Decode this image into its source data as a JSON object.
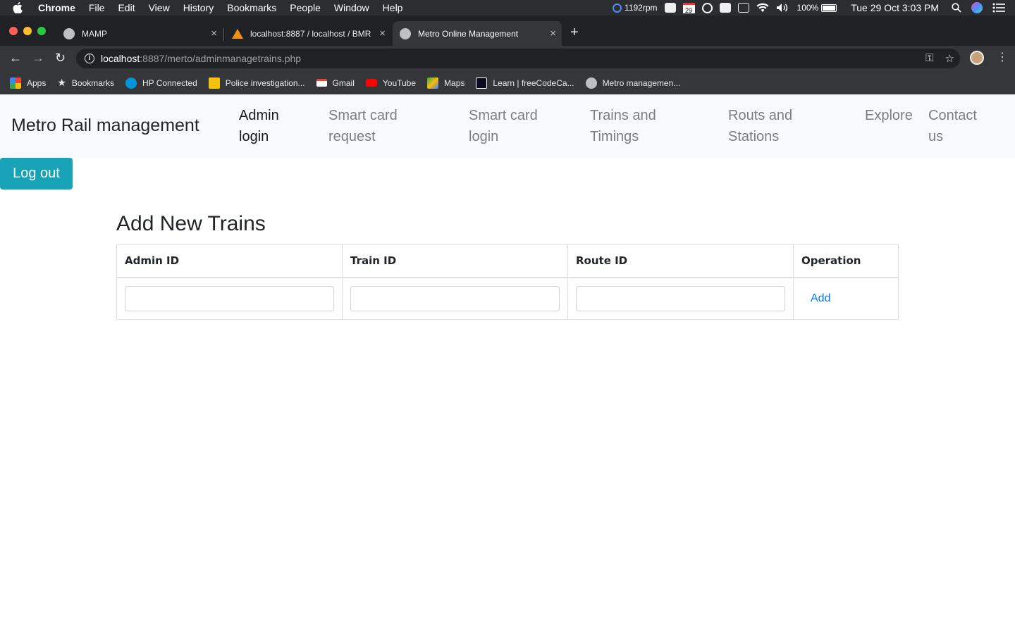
{
  "menubar": {
    "items": [
      "Chrome",
      "File",
      "Edit",
      "View",
      "History",
      "Bookmarks",
      "People",
      "Window",
      "Help"
    ],
    "status": {
      "fan": "1192rpm",
      "calendar_day": "29",
      "battery": "100%",
      "datetime": "Tue 29 Oct  3:03 PM"
    }
  },
  "tabs": [
    {
      "title": "MAMP",
      "close": "×"
    },
    {
      "title": "localhost:8887 / localhost / BMR",
      "close": "×"
    },
    {
      "title": "Metro Online Management",
      "close": "×"
    }
  ],
  "toolbar": {
    "back": "←",
    "forward": "→",
    "reload": "↻",
    "url_host": "localhost",
    "url_path": ":8887/merto/adminmanagetrains.php",
    "key_icon": "⚿",
    "star_icon": "☆",
    "menu_icon": "⋮",
    "new_tab": "+"
  },
  "bookmarks": [
    {
      "label": "Apps",
      "color": "#4285f4"
    },
    {
      "label": "Bookmarks",
      "color": "#e8eaed"
    },
    {
      "label": "HP Connected",
      "color": "#0096d6"
    },
    {
      "label": "Police investigation...",
      "color": "#f4c20d"
    },
    {
      "label": "Gmail",
      "color": "#ea4335"
    },
    {
      "label": "YouTube",
      "color": "#ff0000"
    },
    {
      "label": "Maps",
      "color": "#34a853"
    },
    {
      "label": "Learn | freeCodeCa...",
      "color": "#0a0a23"
    },
    {
      "label": "Metro managemen...",
      "color": "#bdc1c6"
    }
  ],
  "site": {
    "brand": "Metro Rail management",
    "nav": [
      {
        "line1": "Admin",
        "line2": "login"
      },
      {
        "line1": "Smart card",
        "line2": "request"
      },
      {
        "line1": "Smart card",
        "line2": "login"
      },
      {
        "line1": "Trains and",
        "line2": "Timings"
      },
      {
        "line1": "Routs and",
        "line2": "Stations"
      },
      {
        "line1": "Explore",
        "line2": ""
      },
      {
        "line1": "Contact",
        "line2": "us"
      }
    ],
    "logout_label": "Log out",
    "heading": "Add New Trains",
    "table": {
      "headers": [
        "Admin ID",
        "Train ID",
        "Route ID",
        "Operation"
      ],
      "inputs": {
        "admin_id": "",
        "train_id": "",
        "route_id": ""
      },
      "action_label": "Add"
    }
  },
  "colors": {
    "accent_button": "#17a2b8",
    "link": "#007bff",
    "navbar_bg": "#f8f9fa"
  }
}
